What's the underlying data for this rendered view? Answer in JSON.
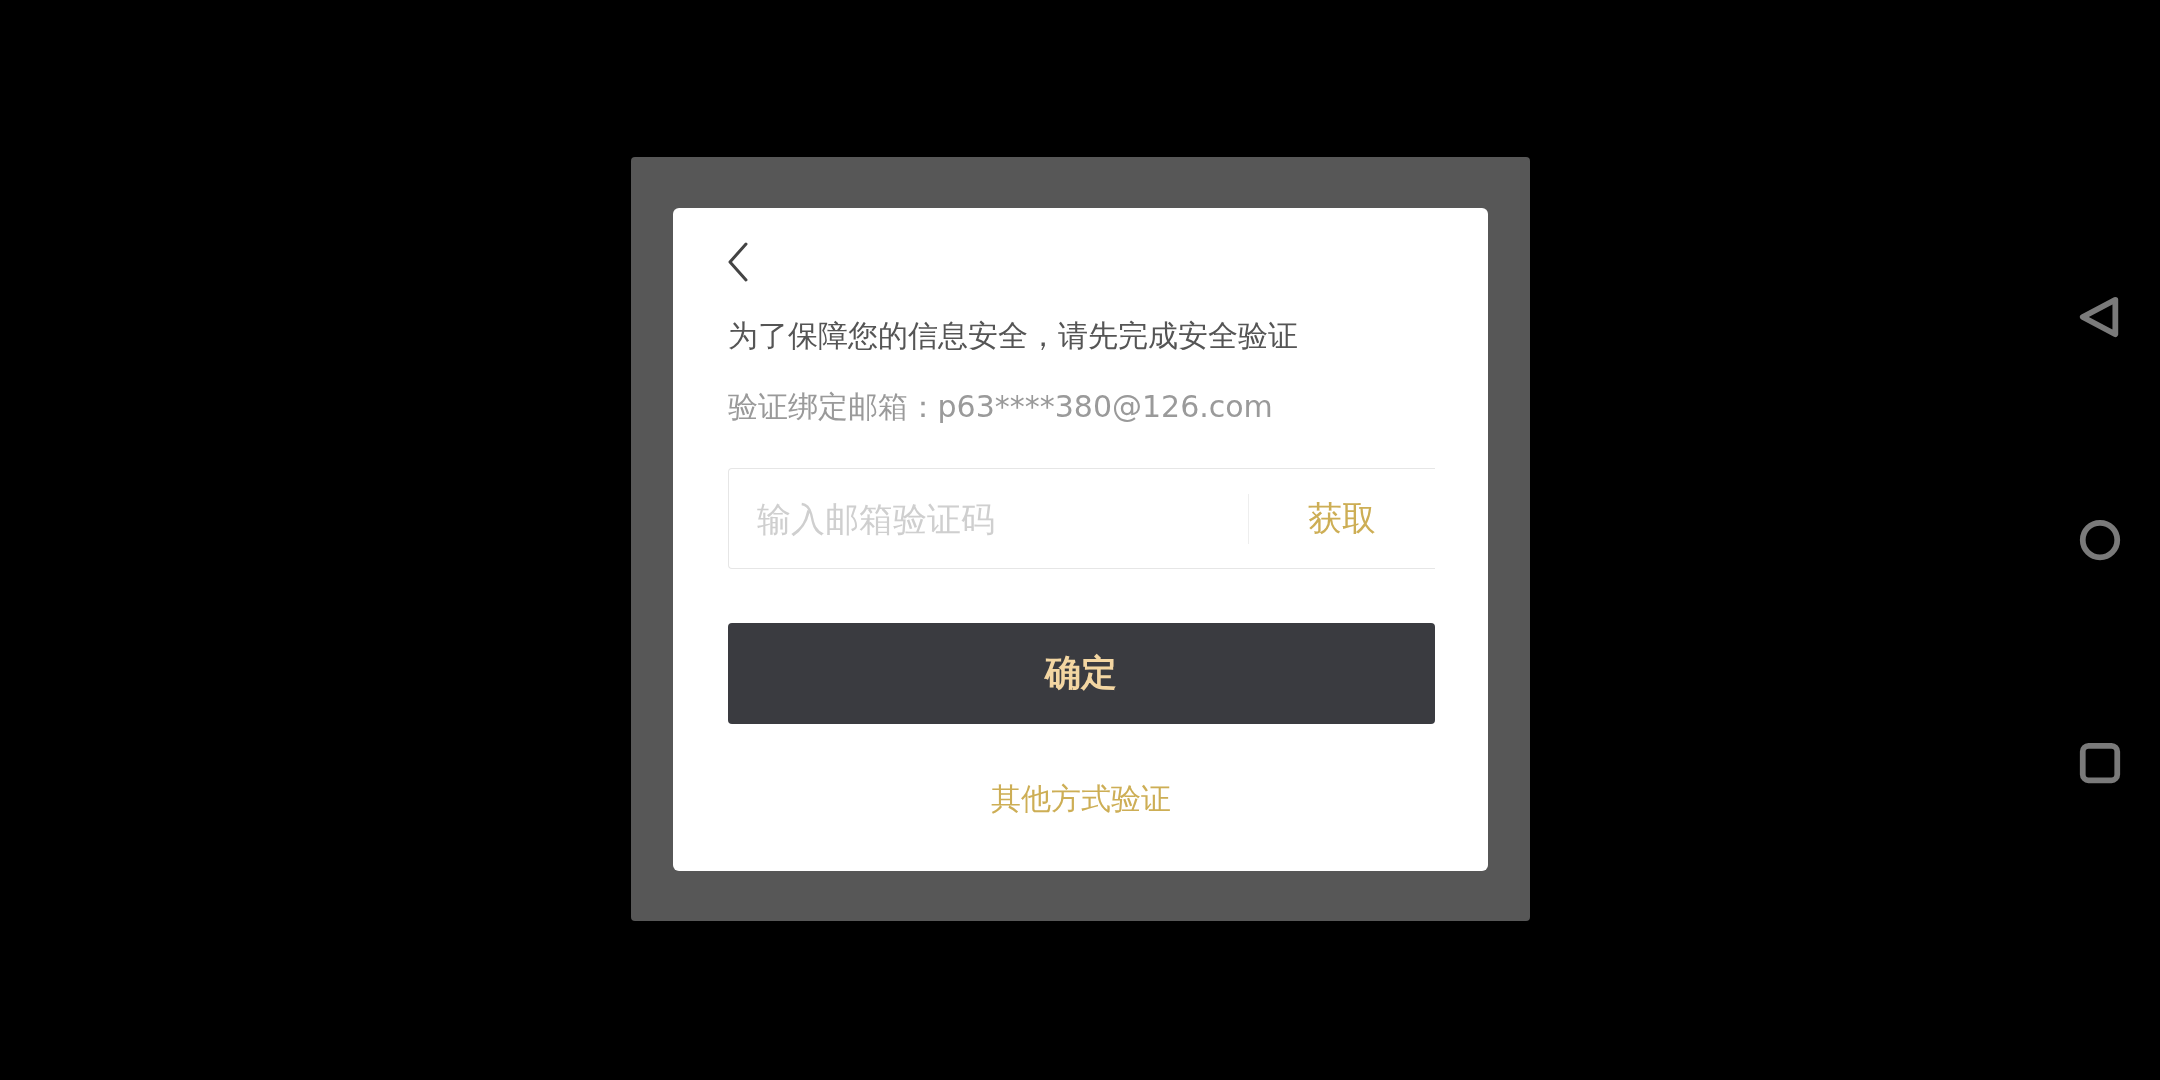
{
  "dialog": {
    "message": "为了保障您的信息安全，请先完成安全验证",
    "bound_email": "验证绑定邮箱：p63****380@126.com",
    "code_field": {
      "placeholder": "输入邮箱验证码"
    },
    "get_code_button": {
      "label": "获取"
    },
    "confirm_button": {
      "label": "确定"
    },
    "other_methods_link": {
      "label": "其他方式验证"
    }
  },
  "nav_bar": {
    "buttons": [
      {
        "kind": "back"
      },
      {
        "kind": "home"
      },
      {
        "kind": "recent"
      }
    ]
  }
}
